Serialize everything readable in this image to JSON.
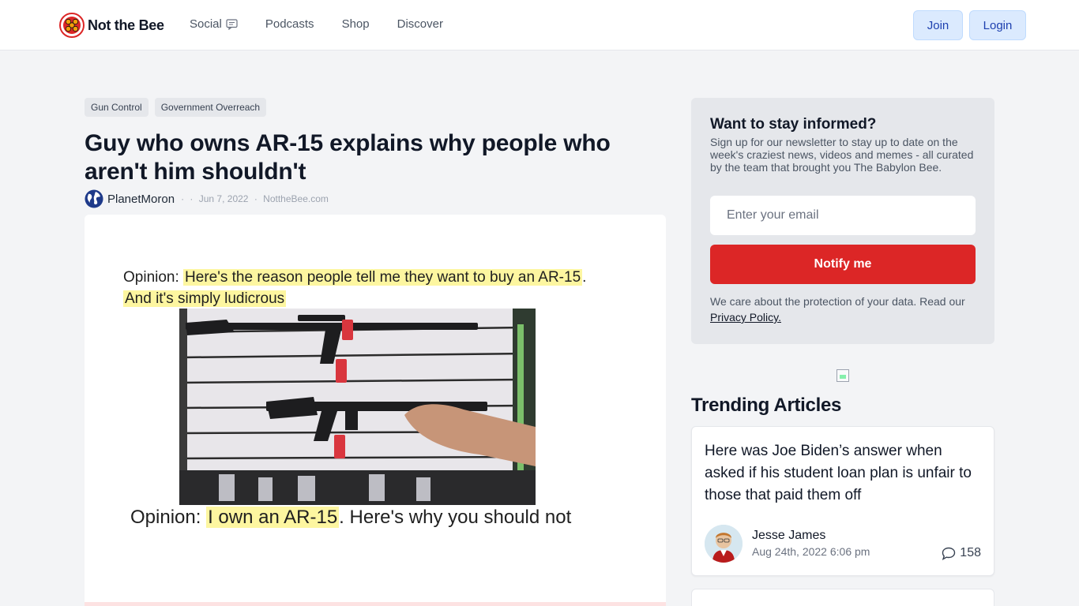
{
  "brand": {
    "name": "Not the Bee"
  },
  "nav": {
    "items": [
      {
        "label": "Social",
        "icon": "chat-icon"
      },
      {
        "label": "Podcasts"
      },
      {
        "label": "Shop"
      },
      {
        "label": "Discover"
      }
    ]
  },
  "header": {
    "join_label": "Join",
    "login_label": "Login"
  },
  "article": {
    "tags": [
      "Gun Control",
      "Government Overreach"
    ],
    "title": "Guy who owns AR-15 explains why people who aren't him shouldn't",
    "author": "PlanetMoron",
    "separator": "·",
    "date": "Jun 7, 2022",
    "source": "NottheBee.com",
    "image": {
      "caption_top_prefix": "Opinion: ",
      "caption_top_highlight": "Here's the reason people tell me they want to buy an AR-15",
      "caption_top_after": ".",
      "caption_top_highlight2": "And it's simply ludicrous",
      "caption_bottom_prefix": "Opinion: ",
      "caption_bottom_highlight": "I own an AR-15",
      "caption_bottom_after": ". Here's why you should not",
      "highlight_color": "#fdf6a0"
    }
  },
  "newsletter": {
    "title": "Want to stay informed?",
    "description": "Sign up for our newsletter to stay up to date on the week's craziest news, videos and memes - all curated by the team that brought you The Babylon Bee.",
    "email_placeholder": "Enter your email",
    "button_label": "Notify me",
    "privacy_text": "We care about the protection of your data. Read our ",
    "privacy_link": "Privacy Policy."
  },
  "trending": {
    "heading": "Trending Articles",
    "items": [
      {
        "headline": "Here was Joe Biden’s answer when asked if his student loan plan is unfair to those that paid them off",
        "author": "Jesse James",
        "date": "Aug 24th, 2022 6:06 pm",
        "comments": "158"
      }
    ]
  },
  "colors": {
    "accent": "#dc2626",
    "header_button_bg": "#dbeafe",
    "header_button_text": "#1e40af",
    "page_bg": "#f3f4f6"
  }
}
